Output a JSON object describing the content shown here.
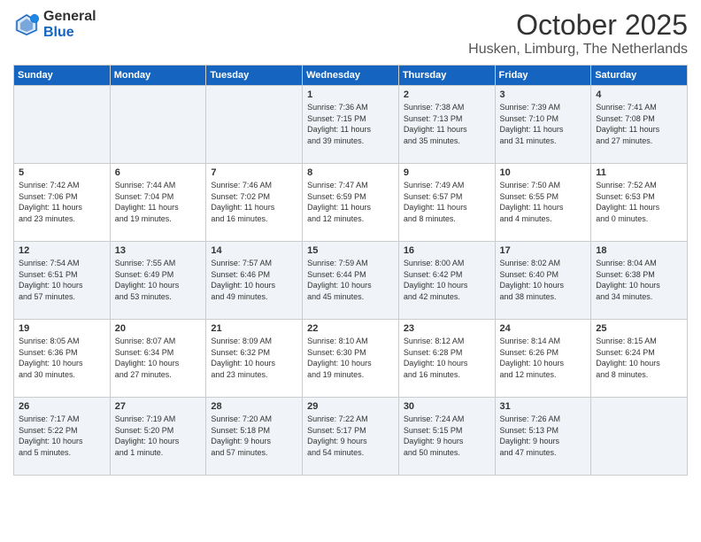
{
  "header": {
    "logo_general": "General",
    "logo_blue": "Blue",
    "month_title": "October 2025",
    "location": "Husken, Limburg, The Netherlands"
  },
  "days_of_week": [
    "Sunday",
    "Monday",
    "Tuesday",
    "Wednesday",
    "Thursday",
    "Friday",
    "Saturday"
  ],
  "weeks": [
    [
      {
        "day": "",
        "info": ""
      },
      {
        "day": "",
        "info": ""
      },
      {
        "day": "",
        "info": ""
      },
      {
        "day": "1",
        "info": "Sunrise: 7:36 AM\nSunset: 7:15 PM\nDaylight: 11 hours\nand 39 minutes."
      },
      {
        "day": "2",
        "info": "Sunrise: 7:38 AM\nSunset: 7:13 PM\nDaylight: 11 hours\nand 35 minutes."
      },
      {
        "day": "3",
        "info": "Sunrise: 7:39 AM\nSunset: 7:10 PM\nDaylight: 11 hours\nand 31 minutes."
      },
      {
        "day": "4",
        "info": "Sunrise: 7:41 AM\nSunset: 7:08 PM\nDaylight: 11 hours\nand 27 minutes."
      }
    ],
    [
      {
        "day": "5",
        "info": "Sunrise: 7:42 AM\nSunset: 7:06 PM\nDaylight: 11 hours\nand 23 minutes."
      },
      {
        "day": "6",
        "info": "Sunrise: 7:44 AM\nSunset: 7:04 PM\nDaylight: 11 hours\nand 19 minutes."
      },
      {
        "day": "7",
        "info": "Sunrise: 7:46 AM\nSunset: 7:02 PM\nDaylight: 11 hours\nand 16 minutes."
      },
      {
        "day": "8",
        "info": "Sunrise: 7:47 AM\nSunset: 6:59 PM\nDaylight: 11 hours\nand 12 minutes."
      },
      {
        "day": "9",
        "info": "Sunrise: 7:49 AM\nSunset: 6:57 PM\nDaylight: 11 hours\nand 8 minutes."
      },
      {
        "day": "10",
        "info": "Sunrise: 7:50 AM\nSunset: 6:55 PM\nDaylight: 11 hours\nand 4 minutes."
      },
      {
        "day": "11",
        "info": "Sunrise: 7:52 AM\nSunset: 6:53 PM\nDaylight: 11 hours\nand 0 minutes."
      }
    ],
    [
      {
        "day": "12",
        "info": "Sunrise: 7:54 AM\nSunset: 6:51 PM\nDaylight: 10 hours\nand 57 minutes."
      },
      {
        "day": "13",
        "info": "Sunrise: 7:55 AM\nSunset: 6:49 PM\nDaylight: 10 hours\nand 53 minutes."
      },
      {
        "day": "14",
        "info": "Sunrise: 7:57 AM\nSunset: 6:46 PM\nDaylight: 10 hours\nand 49 minutes."
      },
      {
        "day": "15",
        "info": "Sunrise: 7:59 AM\nSunset: 6:44 PM\nDaylight: 10 hours\nand 45 minutes."
      },
      {
        "day": "16",
        "info": "Sunrise: 8:00 AM\nSunset: 6:42 PM\nDaylight: 10 hours\nand 42 minutes."
      },
      {
        "day": "17",
        "info": "Sunrise: 8:02 AM\nSunset: 6:40 PM\nDaylight: 10 hours\nand 38 minutes."
      },
      {
        "day": "18",
        "info": "Sunrise: 8:04 AM\nSunset: 6:38 PM\nDaylight: 10 hours\nand 34 minutes."
      }
    ],
    [
      {
        "day": "19",
        "info": "Sunrise: 8:05 AM\nSunset: 6:36 PM\nDaylight: 10 hours\nand 30 minutes."
      },
      {
        "day": "20",
        "info": "Sunrise: 8:07 AM\nSunset: 6:34 PM\nDaylight: 10 hours\nand 27 minutes."
      },
      {
        "day": "21",
        "info": "Sunrise: 8:09 AM\nSunset: 6:32 PM\nDaylight: 10 hours\nand 23 minutes."
      },
      {
        "day": "22",
        "info": "Sunrise: 8:10 AM\nSunset: 6:30 PM\nDaylight: 10 hours\nand 19 minutes."
      },
      {
        "day": "23",
        "info": "Sunrise: 8:12 AM\nSunset: 6:28 PM\nDaylight: 10 hours\nand 16 minutes."
      },
      {
        "day": "24",
        "info": "Sunrise: 8:14 AM\nSunset: 6:26 PM\nDaylight: 10 hours\nand 12 minutes."
      },
      {
        "day": "25",
        "info": "Sunrise: 8:15 AM\nSunset: 6:24 PM\nDaylight: 10 hours\nand 8 minutes."
      }
    ],
    [
      {
        "day": "26",
        "info": "Sunrise: 7:17 AM\nSunset: 5:22 PM\nDaylight: 10 hours\nand 5 minutes."
      },
      {
        "day": "27",
        "info": "Sunrise: 7:19 AM\nSunset: 5:20 PM\nDaylight: 10 hours\nand 1 minute."
      },
      {
        "day": "28",
        "info": "Sunrise: 7:20 AM\nSunset: 5:18 PM\nDaylight: 9 hours\nand 57 minutes."
      },
      {
        "day": "29",
        "info": "Sunrise: 7:22 AM\nSunset: 5:17 PM\nDaylight: 9 hours\nand 54 minutes."
      },
      {
        "day": "30",
        "info": "Sunrise: 7:24 AM\nSunset: 5:15 PM\nDaylight: 9 hours\nand 50 minutes."
      },
      {
        "day": "31",
        "info": "Sunrise: 7:26 AM\nSunset: 5:13 PM\nDaylight: 9 hours\nand 47 minutes."
      },
      {
        "day": "",
        "info": ""
      }
    ]
  ]
}
